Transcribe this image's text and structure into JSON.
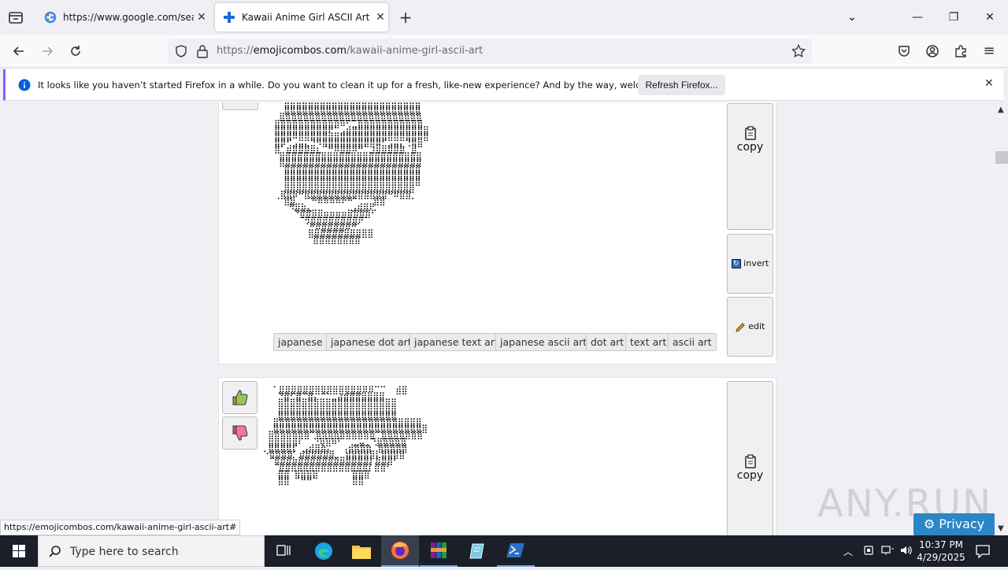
{
  "browser": {
    "tabs": [
      {
        "title": "https://www.google.com/search",
        "favicon": "google-icon"
      },
      {
        "title": "Kawaii Anime Girl ASCII Art | Co",
        "favicon": "emojicombos-plus-icon"
      }
    ],
    "url": {
      "prefix": "https://",
      "domain": "emojicombos.com",
      "path": "/kawaii-anime-girl-ascii-art"
    },
    "notification": {
      "text": "It looks like you haven’t started Firefox in a while. Do you want to clean it up for a fresh, like-new experience? And by the way, welcome back!",
      "button": "Refresh Firefox..."
    },
    "status_url": "https://emojicombos.com/kawaii-anime-girl-ascii-art#"
  },
  "cards": [
    {
      "buttons": {
        "copy": "copy",
        "invert": "invert",
        "edit": "edit"
      },
      "tags": [
        "japanese",
        "japanese dot art",
        "japanese text art",
        "japanese ascii art",
        "dot art",
        "text art",
        "ascii art"
      ]
    },
    {
      "buttons": {
        "copy": "copy"
      }
    }
  ],
  "overlay": {
    "watermark": "ANY.RUN",
    "privacy": "Privacy"
  },
  "taskbar": {
    "search_placeholder": "Type here to search",
    "time": "10:37 PM",
    "date": "4/29/2025"
  },
  "colors": {
    "accent": "#9059ff",
    "privacy": "#2b86c5",
    "taskbar": "#1b1f2a"
  }
}
